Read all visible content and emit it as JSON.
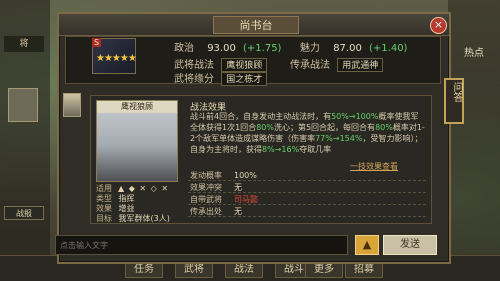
{
  "background": {
    "left_tags": [
      "将",
      "战报"
    ],
    "right_labels": [
      "热点",
      "问答"
    ],
    "bottom_items": [
      "任务",
      "武将",
      "战法",
      "战斗",
      "更多",
      "招募"
    ]
  },
  "modal": {
    "title": "尚书台",
    "close_label": "×"
  },
  "hero": {
    "badge": "S",
    "stars": "★★★★★",
    "stats": {
      "politics_label": "政治",
      "politics_value": "93.00",
      "politics_bonus": "(+1.75)",
      "charm_label": "魅力",
      "charm_value": "87.00",
      "charm_bonus": "(+1.40)"
    },
    "tags": {
      "self_tactic_label": "武将战法",
      "self_tactic": "鹰视狼顾",
      "inherit_label": "传承战法",
      "inherit": "用武通神",
      "fate_label": "武将缘分",
      "fate": "国之栋才"
    }
  },
  "side_tab": {
    "label": "问答"
  },
  "card": {
    "art_title": "鹰视狼顾",
    "meta": [
      {
        "k": "适用",
        "v": ""
      },
      {
        "k": "类型",
        "v": "指挥"
      },
      {
        "k": "效果",
        "v": "增益"
      },
      {
        "k": "目标",
        "v": "我军群体(3人)"
      }
    ],
    "meta_icons": "▲ ◆ ✕ ◇ ✕",
    "desc_title": "战法效果",
    "desc_parts": {
      "p1": "战斗前4回合，自身发动主动战法时，有",
      "p1_hl": "50%→100%",
      "p2": "概率使我军全体获得1次1回合",
      "p2_hl": "80%",
      "p3": "洗心；第5回合起，每回合有",
      "p3_hl": "80%",
      "p4": "概率对1-2个敌军单体造成谋略伤害（伤害率",
      "p4_hl": "77%→154%",
      "p5": "，受智力影响）；自身为主将时，获得",
      "p5_hl": "8%→16%",
      "p6": "夺取几率"
    },
    "desc_link": "一技效果查看",
    "props": [
      {
        "k": "发动概率",
        "v": "100%"
      },
      {
        "k": "效果冲突",
        "v": "无"
      },
      {
        "k": "自带武将",
        "v": "司马懿"
      },
      {
        "k": "传承出处",
        "v": "无"
      }
    ]
  },
  "chat": {
    "placeholder": "点击输入文字",
    "up_icon": "▲",
    "send_label": "发送"
  }
}
